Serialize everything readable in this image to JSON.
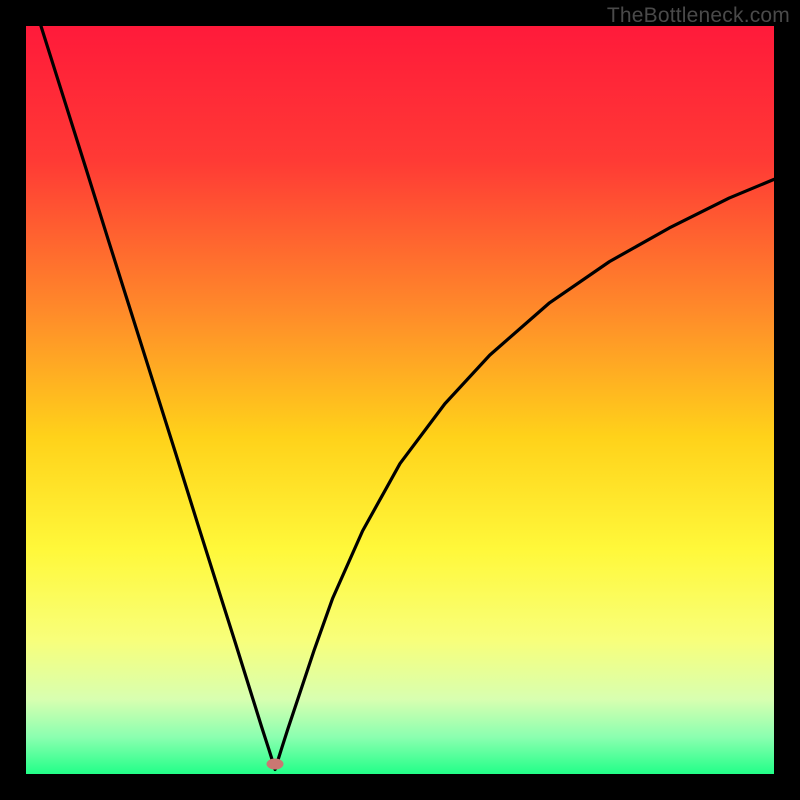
{
  "watermark": "TheBottleneck.com",
  "chart_data": {
    "type": "line",
    "title": "",
    "xlabel": "",
    "ylabel": "",
    "xlim": [
      0,
      100
    ],
    "ylim": [
      0,
      100
    ],
    "gradient_stops": [
      {
        "offset": 0.0,
        "color": "#ff1a3a"
      },
      {
        "offset": 0.18,
        "color": "#ff3a35"
      },
      {
        "offset": 0.38,
        "color": "#ff8a2a"
      },
      {
        "offset": 0.55,
        "color": "#ffd21a"
      },
      {
        "offset": 0.7,
        "color": "#fff83a"
      },
      {
        "offset": 0.82,
        "color": "#f8ff7a"
      },
      {
        "offset": 0.9,
        "color": "#d8ffb0"
      },
      {
        "offset": 0.95,
        "color": "#8cffb0"
      },
      {
        "offset": 1.0,
        "color": "#22ff88"
      }
    ],
    "series": [
      {
        "name": "bottleneck-curve",
        "x": [
          0,
          2,
          5,
          8,
          11,
          14,
          17,
          20,
          23,
          26,
          28,
          30,
          31.5,
          32.5,
          33.0,
          33.3,
          33.6,
          34.2,
          35,
          36.5,
          38.5,
          41,
          45,
          50,
          56,
          62,
          70,
          78,
          86,
          94,
          100
        ],
        "y": [
          106,
          100.0,
          90.5,
          81.0,
          71.4,
          61.9,
          52.4,
          42.9,
          33.3,
          23.8,
          17.5,
          11.1,
          6.3,
          3.2,
          1.6,
          0.6,
          1.6,
          3.5,
          6.0,
          10.5,
          16.5,
          23.5,
          32.5,
          41.5,
          49.5,
          56.0,
          63.0,
          68.5,
          73.0,
          77.0,
          79.5
        ]
      }
    ],
    "marker": {
      "x": 33.3,
      "y": 1.4
    }
  }
}
